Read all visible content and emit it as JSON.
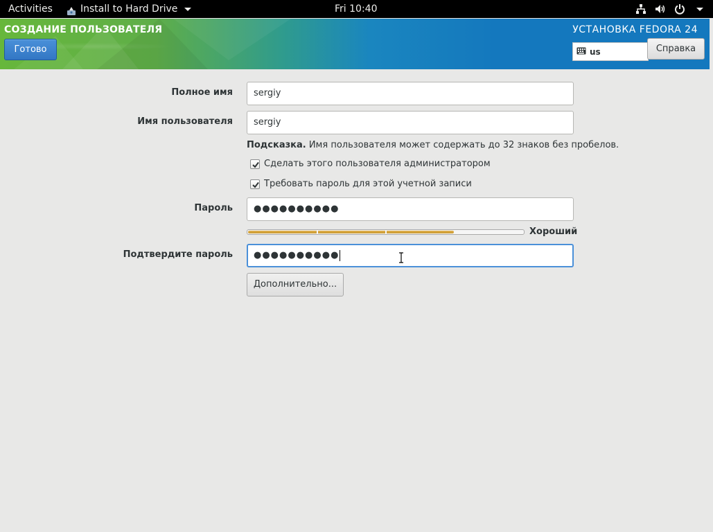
{
  "topbar": {
    "activities": "Activities",
    "app_menu": "Install to Hard Drive",
    "clock": "Fri 10:40"
  },
  "header": {
    "spoke_title": "СОЗДАНИЕ ПОЛЬЗОВАТЕЛЯ",
    "done_label": "Готово",
    "product_title": "УСТАНОВКА FEDORA 24",
    "keyboard_layout": "us",
    "help_label": "Справка"
  },
  "form": {
    "fullname_label": "Полное имя",
    "fullname_value": "sergiy",
    "username_label": "Имя пользователя",
    "username_value": "sergiy",
    "hint_bold": "Подсказка.",
    "hint_text": " Имя пользователя может содержать до 32 знаков без пробелов.",
    "admin_checkbox_label": "Сделать этого пользователя администратором",
    "admin_checked": true,
    "require_password_label": "Требовать пароль для этой учетной записи",
    "require_password_checked": true,
    "password_label": "Пароль",
    "password_value": "●●●●●●●●●●",
    "strength_label": "Хороший",
    "strength_level": 0.75,
    "confirm_label": "Подтвердите пароль",
    "confirm_value": "●●●●●●●●●●",
    "advanced_label": "Дополнительно..."
  },
  "colors": {
    "accent": "#4a90d9",
    "header_green": "#67b73b",
    "header_blue": "#1478be",
    "strength_fill": "#c6952c"
  }
}
